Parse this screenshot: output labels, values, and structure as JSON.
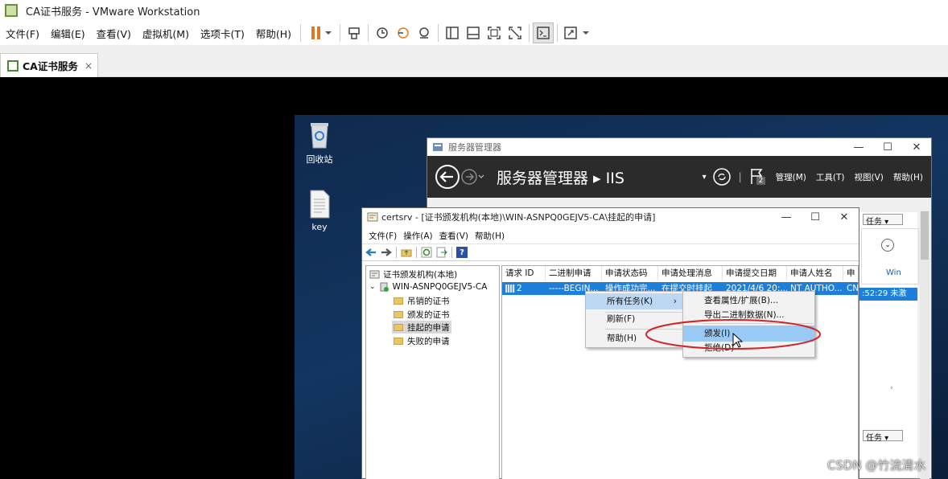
{
  "vmware": {
    "title": "CA证书服务 - VMware Workstation",
    "menus": [
      "文件(F)",
      "编辑(E)",
      "查看(V)",
      "虚拟机(M)",
      "选项卡(T)",
      "帮助(H)"
    ],
    "tab_label": "CA证书服务",
    "tab_close": "×"
  },
  "desktop": {
    "icons": [
      {
        "label": "回收站",
        "icon": "recycle-bin-icon"
      },
      {
        "label": "key",
        "icon": "document-icon"
      }
    ]
  },
  "server_manager": {
    "title": "服务器管理器",
    "header_title": "服务器管理器 ▸ IIS",
    "flag_badge": "2",
    "menus": [
      "管理(M)",
      "工具(T)",
      "视图(V)",
      "帮助(H)"
    ],
    "task_button": "任务",
    "task_button2": "任务",
    "row_time": ":52:29",
    "row_status": "未激",
    "col_win": "Win"
  },
  "certsrv": {
    "title": "certsrv - [证书颁发机构(本地)\\WIN-ASNPQ0GEJV5-CA\\挂起的申请]",
    "menus": [
      "文件(F)",
      "操作(A)",
      "查看(V)",
      "帮助(H)"
    ],
    "tree": {
      "root": "证书颁发机构(本地)",
      "ca": "WIN-ASNPQ0GEJV5-CA",
      "children": [
        "吊销的证书",
        "颁发的证书",
        "挂起的申请",
        "失败的申请"
      ]
    },
    "columns": [
      "请求 ID",
      "二进制申请",
      "申请状态码",
      "申请处理消息",
      "申请提交日期",
      "申请人姓名",
      "申"
    ],
    "row": {
      "id": "2",
      "binary": "-----BEGIN...",
      "status_code": "操作成功完...",
      "message": "在提交时挂起",
      "date": "2021/4/6 20:...",
      "requester": "NT AUTHO...",
      "extra": "CN"
    }
  },
  "context_menu": {
    "items": [
      "所有任务(K)",
      "刷新(F)",
      "帮助(H)"
    ],
    "submenu_arrow": "›"
  },
  "submenu": {
    "items": [
      "查看属性/扩展(B)...",
      "导出二进制数据(N)...",
      "颁发(I)",
      "拒绝(D)"
    ]
  },
  "watermark": "CSDN @竹流清水",
  "colors": {
    "selection": "#1e7fdb",
    "highlight_item": "#99c9f5",
    "annotation": "#d0262b"
  }
}
